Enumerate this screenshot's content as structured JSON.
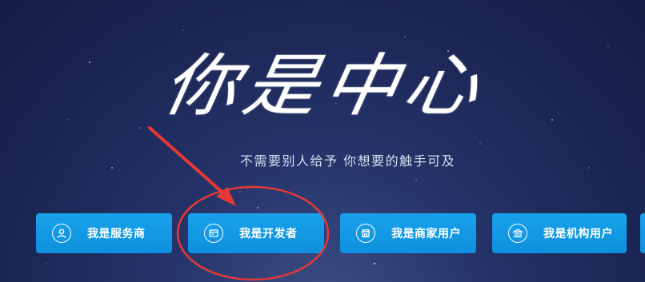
{
  "hero": {
    "title": "你是中心",
    "subtitle": "不需要别人给予 你想要的触手可及"
  },
  "roles": [
    {
      "label": "我是服务商",
      "icon": "user-icon"
    },
    {
      "label": "我是开发者",
      "icon": "browser-window-icon"
    },
    {
      "label": "我是商家用户",
      "icon": "storefront-icon"
    },
    {
      "label": "我是机构用户",
      "icon": "institution-icon"
    }
  ],
  "colors": {
    "background": "#1b2554",
    "button": "#12a0e8",
    "annotation": "#e53935"
  }
}
